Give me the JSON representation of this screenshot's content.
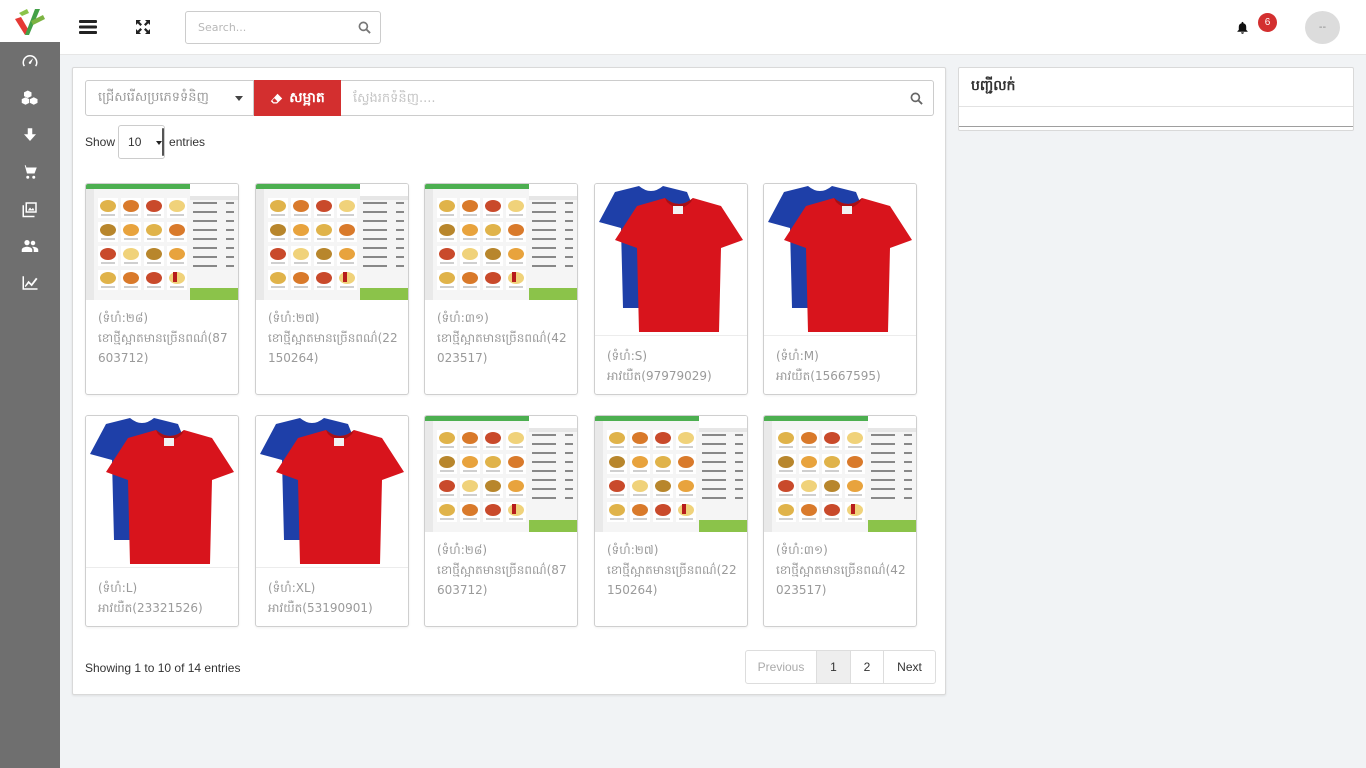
{
  "topbar": {
    "search_placeholder": "Search...",
    "notification_count": "6",
    "avatar_text": "--"
  },
  "sidebar": {
    "items": [
      {
        "icon": "dashboard-icon"
      },
      {
        "icon": "boxes-icon"
      },
      {
        "icon": "download-icon"
      },
      {
        "icon": "cart-icon"
      },
      {
        "icon": "gallery-icon"
      },
      {
        "icon": "users-icon"
      },
      {
        "icon": "chart-icon"
      }
    ]
  },
  "filters": {
    "category_placeholder": "ជ្រើសរើសប្រភេទទំនិញ",
    "clear_label": "សម្អាត",
    "product_search_placeholder": "ស្វែងរកទំនិញ...."
  },
  "table_controls": {
    "show_label": "Show",
    "entries_label": "entries",
    "page_length": "10"
  },
  "products": [
    {
      "kind": "food",
      "caption": "(ទំហំ:២៨)\nខោថ្មីស្អាតមានច្រើនពណ៌(87603712)"
    },
    {
      "kind": "food",
      "caption": "(ទំហំ:២៧)\nខោថ្មីស្អាតមានច្រើនពណ៌(22150264)"
    },
    {
      "kind": "food",
      "caption": "(ទំហំ:៣១)\nខោថ្មីស្អាតមានច្រើនពណ៌(42023517)"
    },
    {
      "kind": "shirt",
      "caption": "(ទំហំ:S)\nអាវយឺត(97979029)"
    },
    {
      "kind": "shirt",
      "caption": "(ទំហំ:M)\nអាវយឺត(15667595)"
    },
    {
      "kind": "shirt",
      "caption": "(ទំហំ:L)\nអាវយឺត(23321526)"
    },
    {
      "kind": "shirt",
      "caption": "(ទំហំ:XL)\nអាវយឺត(53190901)"
    },
    {
      "kind": "food",
      "caption": "(ទំហំ:២៨)\nខោថ្មីស្អាតមានច្រើនពណ៌(87603712)"
    },
    {
      "kind": "food",
      "caption": "(ទំហំ:២៧)\nខោថ្មីស្អាតមានច្រើនពណ៌(22150264)"
    },
    {
      "kind": "food",
      "caption": "(ទំហំ:៣១)\nខោថ្មីស្អាតមានច្រើនពណ៌(42023517)"
    }
  ],
  "pagination": {
    "info": "Showing 1 to 10 of 14 entries",
    "previous": "Previous",
    "pages": [
      "1",
      "2"
    ],
    "next": "Next",
    "current": "1"
  },
  "right_panel": {
    "title": "បញ្ជីលក់"
  },
  "colors": {
    "accent_red": "#d32f2f",
    "sidebar_bg": "#6f6f6f",
    "pos_green": "#4caf50"
  }
}
